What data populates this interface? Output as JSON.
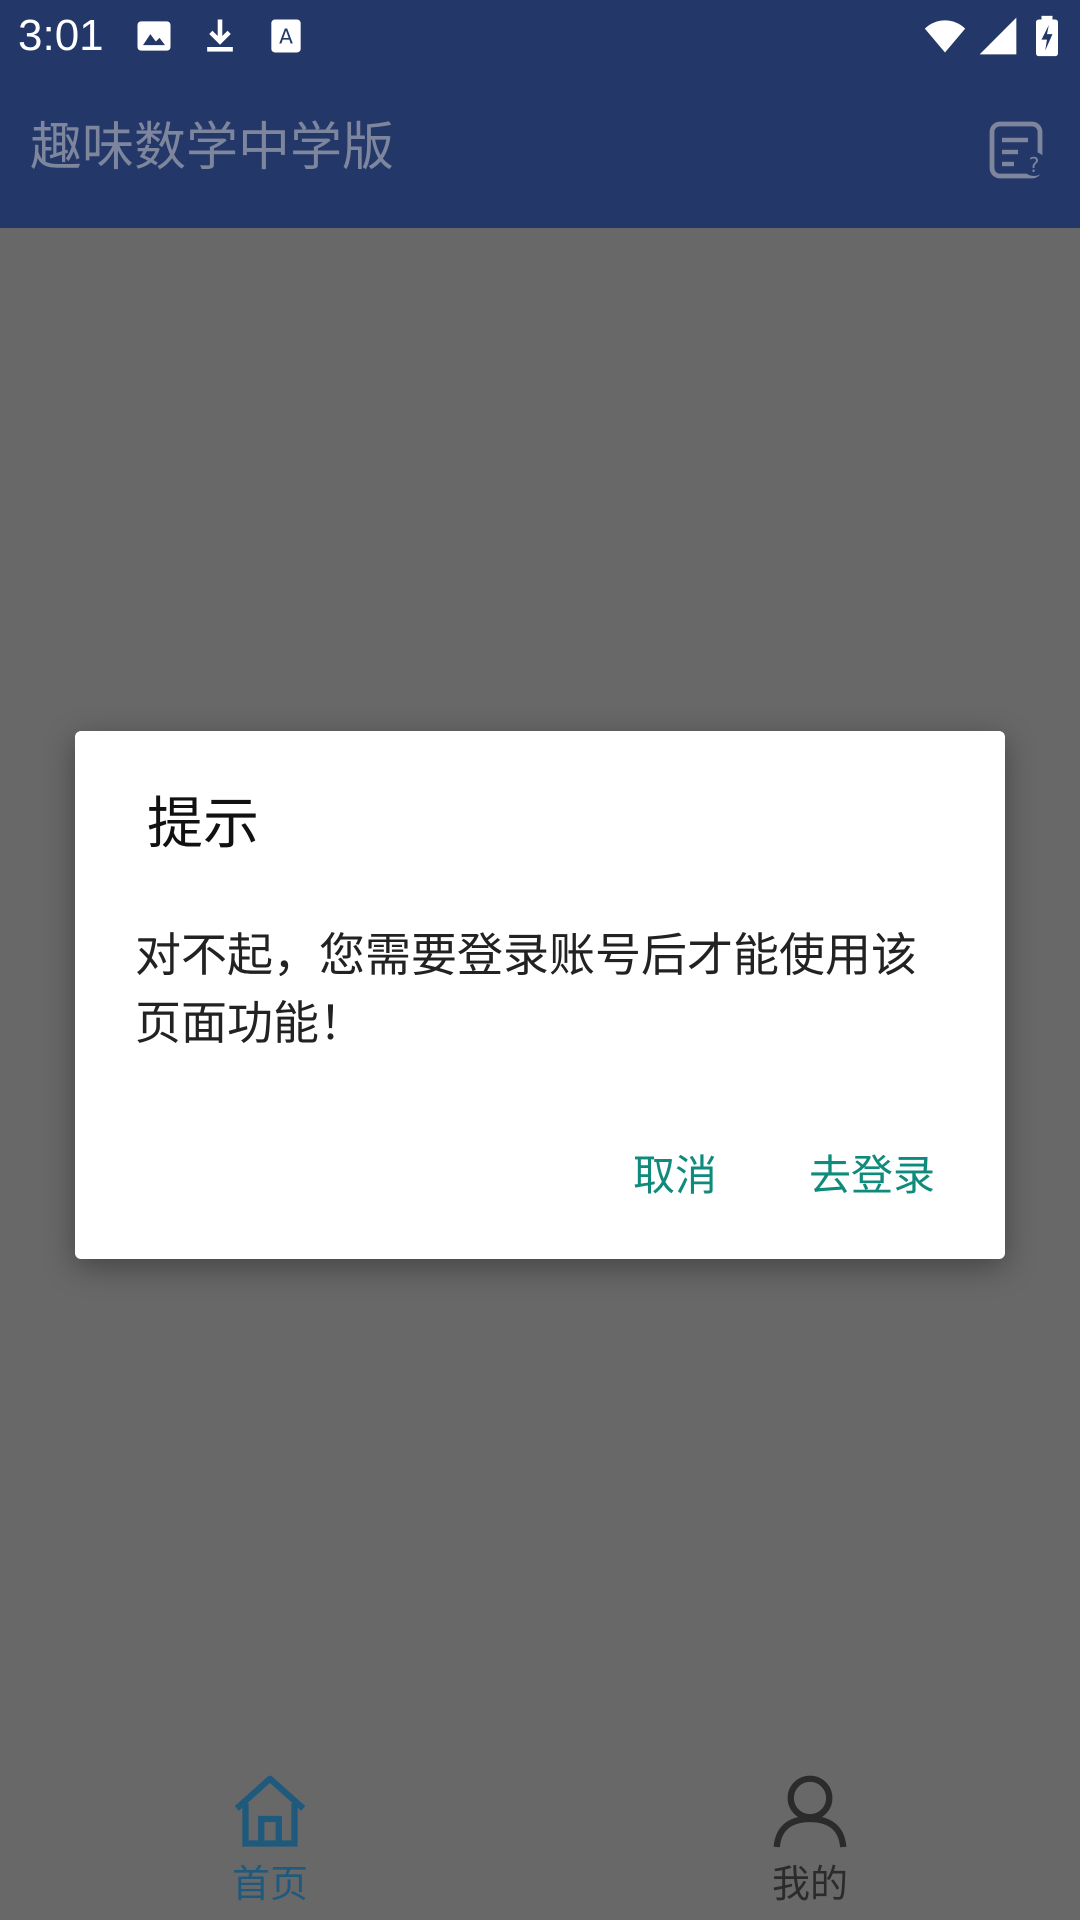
{
  "status_bar": {
    "time": "3:01",
    "left_icons": [
      "image-icon",
      "download-icon",
      "font-icon"
    ],
    "right_icons": [
      "wifi-icon",
      "signal-icon",
      "battery-charging-icon"
    ]
  },
  "app_bar": {
    "title": "趣味数学中学版",
    "action_icon": "help-document-icon"
  },
  "dialog": {
    "title": "提示",
    "message": "对不起，您需要登录账号后才能使用该页面功能！",
    "cancel_label": "取消",
    "login_label": "去登录",
    "accent_color": "#0f8b7c"
  },
  "bottom_nav": {
    "items": [
      {
        "label": "首页",
        "icon": "home-icon",
        "selected": true
      },
      {
        "label": "我的",
        "icon": "person-icon",
        "selected": false
      }
    ]
  }
}
